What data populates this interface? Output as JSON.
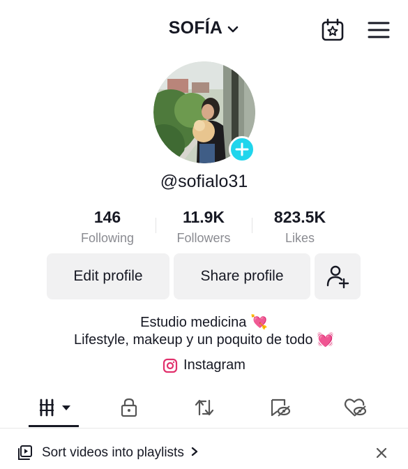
{
  "header": {
    "title": "SOFÍA",
    "calendar_icon": "calendar-star-icon",
    "menu_icon": "hamburger-menu-icon"
  },
  "profile": {
    "username": "@sofialo31",
    "add_icon": "plus-icon"
  },
  "stats": [
    {
      "value": "146",
      "label": "Following"
    },
    {
      "value": "11.9K",
      "label": "Followers"
    },
    {
      "value": "823.5K",
      "label": "Likes"
    }
  ],
  "actions": {
    "edit_profile": "Edit profile",
    "share_profile": "Share profile",
    "add_friend_icon": "add-person-icon"
  },
  "bio": {
    "line1": "Estudio medicina 💘",
    "line2": "Lifestyle, makeup y un poquito de todo 💓"
  },
  "link": {
    "label": "Instagram",
    "icon": "instagram-icon"
  },
  "tabs": [
    {
      "icon": "videos-grid-icon",
      "active": true
    },
    {
      "icon": "lock-icon",
      "active": false
    },
    {
      "icon": "repost-icon",
      "active": false
    },
    {
      "icon": "tagged-eye-icon",
      "active": false
    },
    {
      "icon": "liked-heart-icon",
      "active": false
    }
  ],
  "banner": {
    "text": "Sort videos into playlists",
    "icon": "playlist-icon",
    "close_icon": "close-icon"
  },
  "colors": {
    "accent": "#20d5ec",
    "text": "#161823",
    "muted": "#8a8b91",
    "button_bg": "#f1f1f2",
    "emoji_pink": "#ff3b8b"
  }
}
